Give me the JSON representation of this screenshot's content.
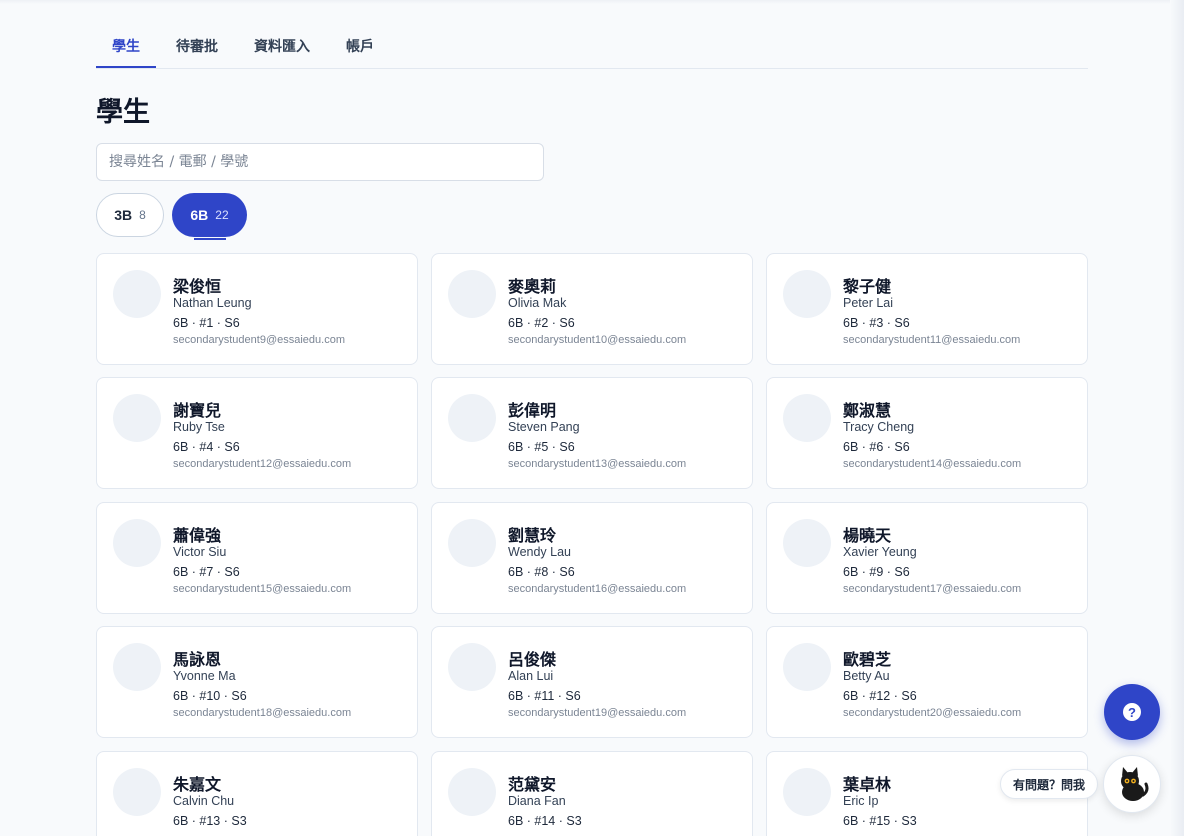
{
  "tabs": [
    {
      "label": "學生",
      "active": true
    },
    {
      "label": "待審批",
      "active": false
    },
    {
      "label": "資料匯入",
      "active": false
    },
    {
      "label": "帳戶",
      "active": false
    }
  ],
  "page_title": "學生",
  "search": {
    "placeholder": "搜尋姓名 / 電郵 / 學號",
    "value": ""
  },
  "class_filters": [
    {
      "label": "3B",
      "count": "8",
      "selected": false
    },
    {
      "label": "6B",
      "count": "22",
      "selected": true
    }
  ],
  "students": [
    {
      "name_zh": "梁俊恒",
      "name_en": "Nathan Leung",
      "meta": "6B · #1 · S6",
      "email": "secondarystudent9@essaiedu.com"
    },
    {
      "name_zh": "麥奧莉",
      "name_en": "Olivia Mak",
      "meta": "6B · #2 · S6",
      "email": "secondarystudent10@essaiedu.com"
    },
    {
      "name_zh": "黎子健",
      "name_en": "Peter Lai",
      "meta": "6B · #3 · S6",
      "email": "secondarystudent11@essaiedu.com"
    },
    {
      "name_zh": "謝寶兒",
      "name_en": "Ruby Tse",
      "meta": "6B · #4 · S6",
      "email": "secondarystudent12@essaiedu.com"
    },
    {
      "name_zh": "彭偉明",
      "name_en": "Steven Pang",
      "meta": "6B · #5 · S6",
      "email": "secondarystudent13@essaiedu.com"
    },
    {
      "name_zh": "鄭淑慧",
      "name_en": "Tracy Cheng",
      "meta": "6B · #6 · S6",
      "email": "secondarystudent14@essaiedu.com"
    },
    {
      "name_zh": "蕭偉強",
      "name_en": "Victor Siu",
      "meta": "6B · #7 · S6",
      "email": "secondarystudent15@essaiedu.com"
    },
    {
      "name_zh": "劉慧玲",
      "name_en": "Wendy Lau",
      "meta": "6B · #8 · S6",
      "email": "secondarystudent16@essaiedu.com"
    },
    {
      "name_zh": "楊曉天",
      "name_en": "Xavier Yeung",
      "meta": "6B · #9 · S6",
      "email": "secondarystudent17@essaiedu.com"
    },
    {
      "name_zh": "馬詠恩",
      "name_en": "Yvonne Ma",
      "meta": "6B · #10 · S6",
      "email": "secondarystudent18@essaiedu.com"
    },
    {
      "name_zh": "呂俊傑",
      "name_en": "Alan Lui",
      "meta": "6B · #11 · S6",
      "email": "secondarystudent19@essaiedu.com"
    },
    {
      "name_zh": "歐碧芝",
      "name_en": "Betty Au",
      "meta": "6B · #12 · S6",
      "email": "secondarystudent20@essaiedu.com"
    },
    {
      "name_zh": "朱嘉文",
      "name_en": "Calvin Chu",
      "meta": "6B · #13 · S3",
      "email": ""
    },
    {
      "name_zh": "范黛安",
      "name_en": "Diana Fan",
      "meta": "6B · #14 · S3",
      "email": ""
    },
    {
      "name_zh": "葉卓林",
      "name_en": "Eric Ip",
      "meta": "6B · #15 · S3",
      "email": ""
    }
  ],
  "help": {
    "button_glyph": "?",
    "ask_label": "有問題？問我"
  },
  "colors": {
    "accent": "#2f45c8",
    "background": "#f8fafc",
    "card_border": "#e2e8f0"
  },
  "icons": {
    "help": "question-circle-icon",
    "mascot": "black-cat-icon"
  }
}
